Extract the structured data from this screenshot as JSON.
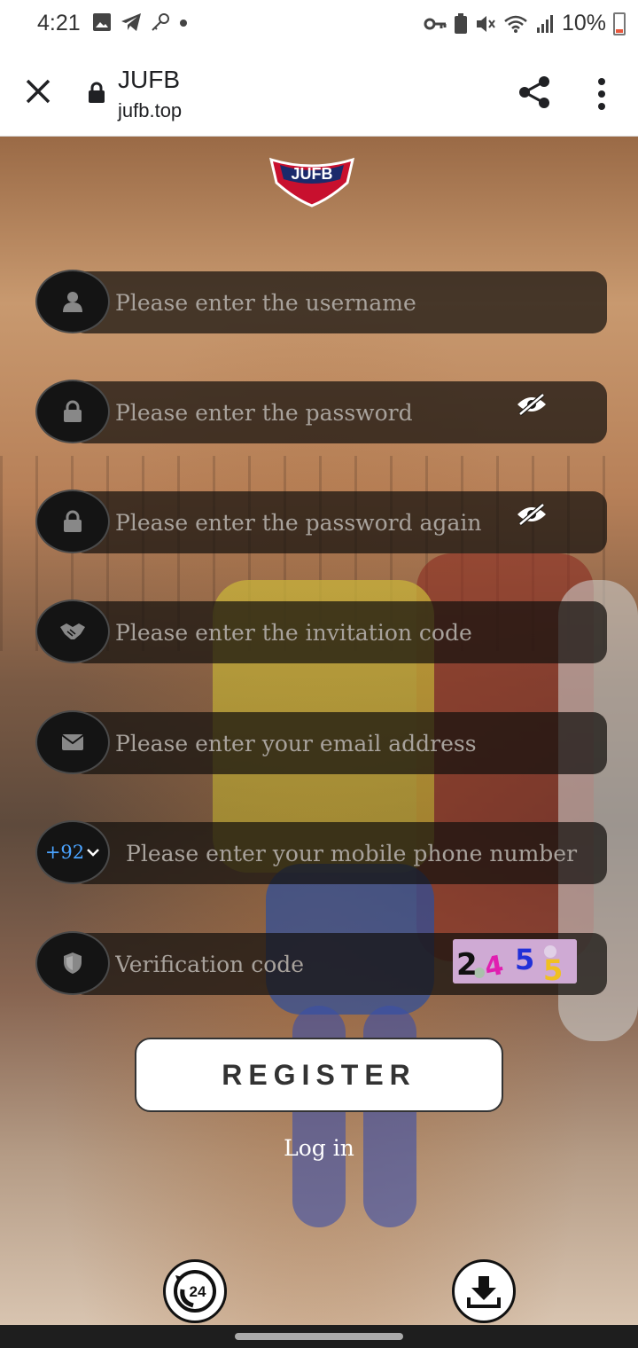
{
  "status_bar": {
    "time": "4:21",
    "battery": "10%"
  },
  "browser": {
    "title": "JUFB",
    "url": "jufb.top"
  },
  "form": {
    "username_placeholder": "Please enter the username",
    "password_placeholder": "Please enter the password",
    "password_again_placeholder": "Please enter the password again",
    "invitation_placeholder": "Please enter the invitation code",
    "email_placeholder": "Please enter your email address",
    "country_code": "+92",
    "phone_placeholder": "Please enter your mobile phone number",
    "verification_placeholder": "Verification code",
    "captcha_chars": [
      "2",
      "4",
      "5",
      "5"
    ]
  },
  "actions": {
    "register_label": "REGISTER",
    "login_label": "Log in"
  },
  "footer": {
    "support_label": "24"
  },
  "colors": {
    "accent_link": "#4aa3ff",
    "field_bg": "#141414"
  }
}
